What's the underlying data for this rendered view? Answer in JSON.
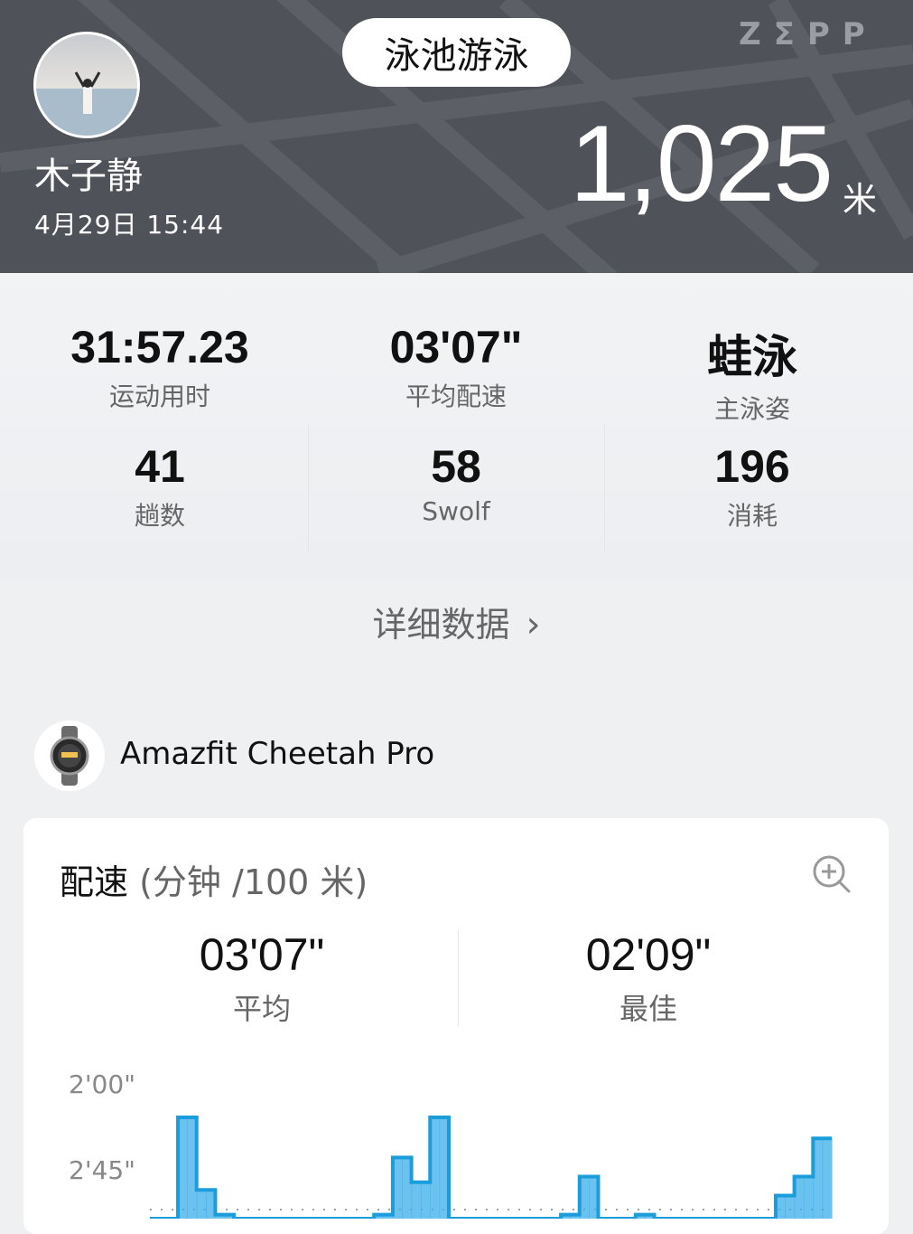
{
  "header": {
    "activity": "泳池游泳",
    "brand": "ZΣPP",
    "user_name": "木子静",
    "date_time": "4月29日 15:44",
    "distance": "1,025",
    "distance_unit": "米"
  },
  "stats": [
    {
      "value": "31:57.23",
      "label": "运动用时"
    },
    {
      "value": "03'07\"",
      "label": "平均配速"
    },
    {
      "value": "蛙泳",
      "label": "主泳姿"
    },
    {
      "value": "41",
      "label": "趟数"
    },
    {
      "value": "58",
      "label": "Swolf"
    },
    {
      "value": "196",
      "label": "消耗"
    }
  ],
  "detail_link": "详细数据",
  "device_name": "Amazfit Cheetah Pro",
  "pace_card": {
    "title": "配速",
    "title_unit": "(分钟 /100 米)",
    "average_value": "03'07\"",
    "average_label": "平均",
    "best_value": "02'09\"",
    "best_label": "最佳"
  },
  "colors": {
    "accent": "#3aaee8",
    "header_bg": "#4f5258"
  },
  "chart_data": {
    "type": "area",
    "y_ticks": [
      "2'00\"",
      "2'45\""
    ],
    "y_inverted": true,
    "note_series_color": "#3aaee8",
    "values_seconds": [
      185,
      185,
      185,
      129,
      129,
      167,
      167,
      180,
      180,
      185,
      185,
      185,
      185,
      185,
      185,
      185,
      185,
      185,
      185,
      185,
      190,
      190,
      185,
      185,
      180,
      180,
      150,
      150,
      163,
      163,
      129,
      129,
      190,
      190,
      185,
      185,
      185,
      185,
      185,
      185,
      185,
      185,
      185,
      185,
      180,
      180,
      160,
      160,
      190,
      190,
      185,
      185,
      180,
      180,
      185,
      185,
      185,
      185,
      185,
      185,
      185,
      185,
      185,
      185,
      185,
      185,
      185,
      170,
      170,
      160,
      160,
      140,
      140
    ]
  }
}
